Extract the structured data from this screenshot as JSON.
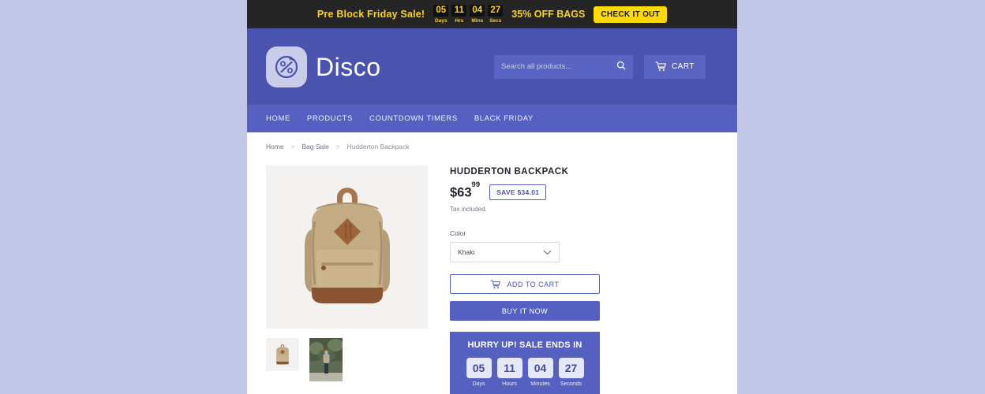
{
  "theme": {
    "page_backdrop": "#c4c8e8",
    "promo_bg": "#252525",
    "promo_accent": "#ffd21a",
    "promo_cta_bg": "#ffd900",
    "header_bg": "#4a53ad",
    "nav_bg": "#5560c0",
    "brand_indigo": "#5560c0",
    "product_khaki": "#c3ab84",
    "product_leather": "#8a5433"
  },
  "promo": {
    "headline": "Pre Block Friday Sale!",
    "offer": "35% OFF BAGS",
    "cta_label": "CHECK IT OUT",
    "timer": [
      {
        "value": "05",
        "label": "Days"
      },
      {
        "value": "11",
        "label": "Hrs"
      },
      {
        "value": "04",
        "label": "Mins"
      },
      {
        "value": "27",
        "label": "Secs"
      }
    ]
  },
  "header": {
    "brand_name": "Disco",
    "logo_icon": "percent-circle-arrow-icon",
    "search": {
      "placeholder": "Search all products...",
      "value": "",
      "icon": "search-icon"
    },
    "cart": {
      "label": "CART",
      "icon": "cart-icon"
    }
  },
  "nav": {
    "items": [
      {
        "label": "HOME"
      },
      {
        "label": "PRODUCTS"
      },
      {
        "label": "COUNTDOWN TIMERS"
      },
      {
        "label": "BLACK FRIDAY"
      }
    ]
  },
  "breadcrumb": {
    "separator": ">",
    "items": [
      {
        "label": "Home"
      },
      {
        "label": "Bag Sale"
      },
      {
        "label": "Hudderton Backpack"
      }
    ]
  },
  "product": {
    "title": "HUDDERTON BACKPACK",
    "price_main": "$63",
    "price_cents": "99",
    "save_badge": "SAVE $34.01",
    "tax_note": "Tax included.",
    "option_label": "Color",
    "selected_color": "Khaki",
    "color_options": [
      "Khaki"
    ],
    "add_to_cart_label": "ADD TO CART",
    "buy_now_label": "BUY IT NOW",
    "gallery": {
      "main_alt": "khaki canvas backpack with brown leather base",
      "thumbs": [
        {
          "alt": "khaki canvas backpack product shot"
        },
        {
          "alt": "person hiking wearing khaki backpack"
        }
      ]
    }
  },
  "countdown": {
    "title": "HURRY UP! SALE ENDS IN",
    "units": [
      {
        "value": "05",
        "label": "Days"
      },
      {
        "value": "11",
        "label": "Hours"
      },
      {
        "value": "04",
        "label": "Minutes"
      },
      {
        "value": "27",
        "label": "Seconds"
      }
    ]
  }
}
